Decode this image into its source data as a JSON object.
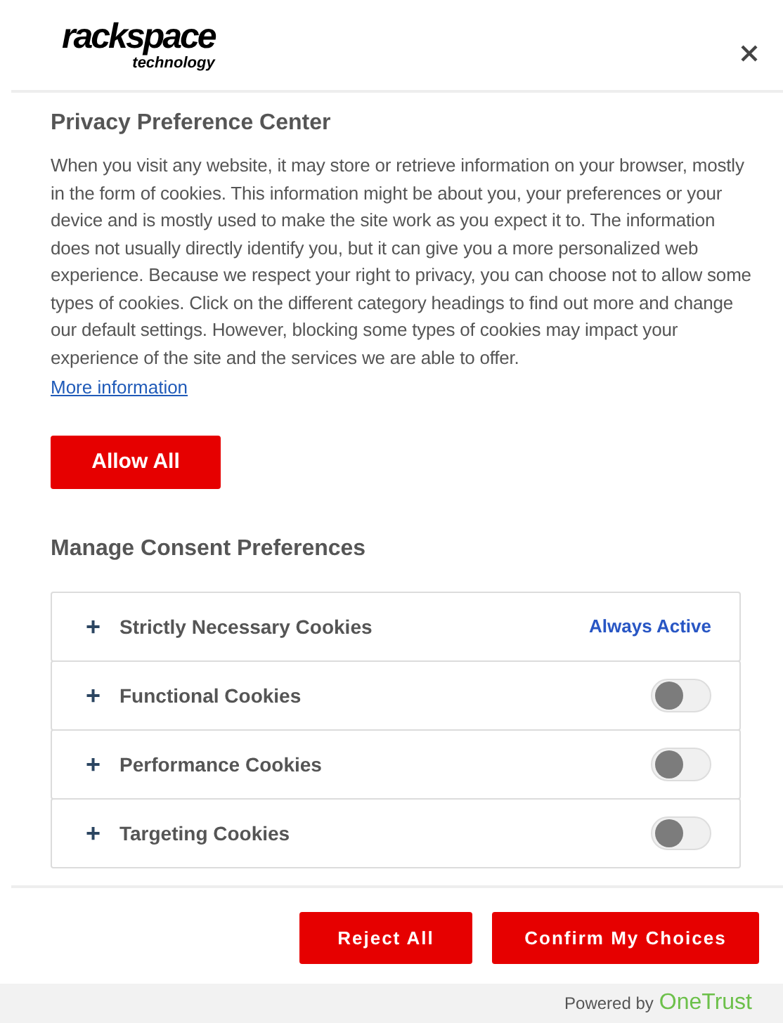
{
  "logo": {
    "name": "rackspace",
    "tagline": "technology"
  },
  "title": "Privacy Preference Center",
  "description": "When you visit any website, it may store or retrieve information on your browser, mostly in the form of cookies. This information might be about you, your preferences or your device and is mostly used to make the site work as you expect it to. The information does not usually directly identify you, but it can give you a more personalized web experience. Because we respect your right to privacy, you can choose not to allow some types of cookies. Click on the different category headings to find out more and change our default settings. However, blocking some types of cookies may impact your experience of the site and the services we are able to offer.",
  "more_link": "More information",
  "allow_all_button": "Allow All",
  "consent_heading": "Manage Consent Preferences",
  "categories": [
    {
      "expander": "+",
      "label": "Strictly Necessary Cookies",
      "kind": "always_active",
      "status": "Always Active"
    },
    {
      "expander": "+",
      "label": "Functional Cookies",
      "kind": "toggle",
      "on": false
    },
    {
      "expander": "+",
      "label": "Performance Cookies",
      "kind": "toggle",
      "on": false
    },
    {
      "expander": "+",
      "label": "Targeting Cookies",
      "kind": "toggle",
      "on": false
    }
  ],
  "buttons": [
    "Reject All",
    "Confirm My Choices"
  ],
  "footer": {
    "prefix": "Powered by",
    "brand": "OneTrust"
  }
}
